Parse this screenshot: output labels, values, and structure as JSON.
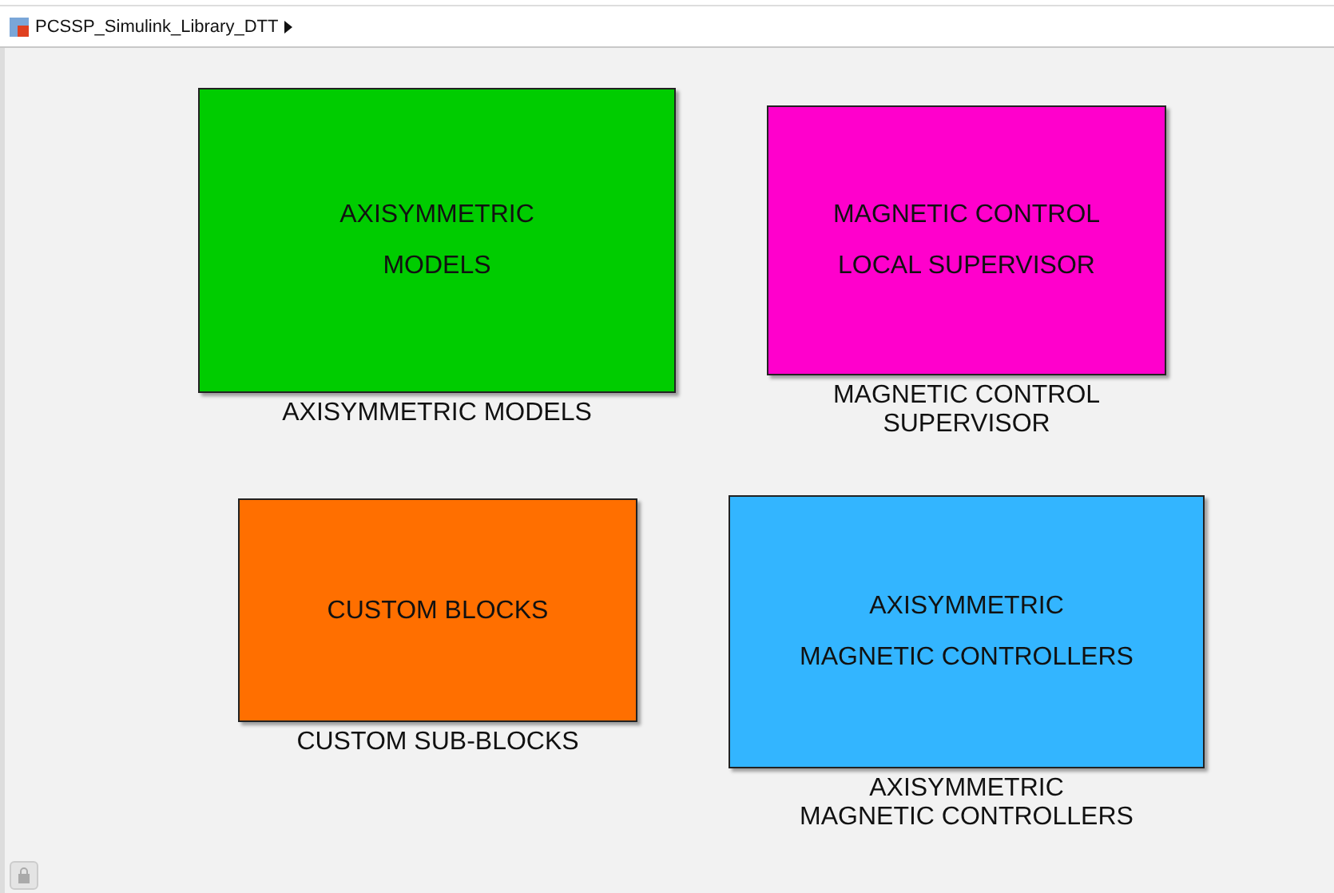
{
  "breadcrumb": {
    "title": "PCSSP_Simulink_Library_DTT"
  },
  "blocks": [
    {
      "lines": [
        "AXISYMMETRIC",
        "MODELS"
      ],
      "caption": [
        "AXISYMMETRIC MODELS"
      ],
      "color": "#00cc00"
    },
    {
      "lines": [
        "MAGNETIC CONTROL",
        "LOCAL SUPERVISOR"
      ],
      "caption": [
        "MAGNETIC CONTROL",
        "SUPERVISOR"
      ],
      "color": "#ff00cc"
    },
    {
      "lines": [
        "CUSTOM BLOCKS"
      ],
      "caption": [
        "CUSTOM SUB-BLOCKS"
      ],
      "color": "#ff6f00"
    },
    {
      "lines": [
        "AXISYMMETRIC",
        "MAGNETIC CONTROLLERS"
      ],
      "caption": [
        "AXISYMMETRIC",
        "MAGNETIC CONTROLLERS"
      ],
      "color": "#33b5ff"
    }
  ]
}
